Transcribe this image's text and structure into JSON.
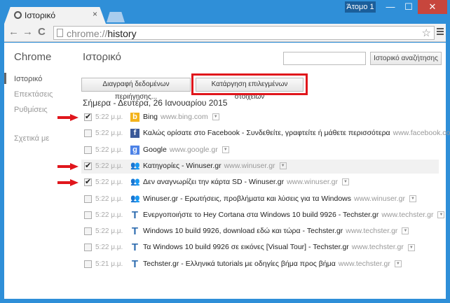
{
  "tab": {
    "title": "Ιστορικό",
    "close": "×"
  },
  "profile": "Άτομο 1",
  "window_buttons": {
    "minimize": "—",
    "maximize": "☐",
    "close": "✕"
  },
  "nav": {
    "back": "←",
    "forward": "→",
    "reload": "C"
  },
  "omnibox": {
    "scheme": "chrome://",
    "path": "history"
  },
  "sidebar": {
    "brand": "Chrome",
    "items": [
      "Ιστορικό",
      "Επεκτάσεις",
      "Ρυθμίσεις"
    ],
    "about": "Σχετικά με"
  },
  "main": {
    "title": "Ιστορικό",
    "search_placeholder": "",
    "search_button": "Ιστορικό αναζήτησης",
    "clear_button": "Διαγραφή δεδομένων περιήγησης...",
    "remove_button": "Κατάργηση επιλεγμένων στοιχείων",
    "date_heading": "Σήμερα - Δευτέρα, 26 Ιανουαρίου 2015"
  },
  "entries": [
    {
      "time": "5:22 μ.μ.",
      "title": "Bing",
      "domain": "www.bing.com",
      "checked": true,
      "icon": "bing-icon"
    },
    {
      "time": "5:22 μ.μ.",
      "title": "Καλώς ορίσατε στο Facebook - Συνδεθείτε, γραφτείτε ή μάθετε περισσότερα",
      "domain": "www.facebook.com",
      "checked": false,
      "icon": "facebook-icon"
    },
    {
      "time": "5:22 μ.μ.",
      "title": "Google",
      "domain": "www.google.gr",
      "checked": false,
      "icon": "google-icon"
    },
    {
      "time": "5:22 μ.μ.",
      "title": "Κατηγορίες - Winuser.gr",
      "domain": "www.winuser.gr",
      "checked": true,
      "icon": "winuser-icon"
    },
    {
      "time": "5:22 μ.μ.",
      "title": "Δεν αναγνωρίζει την κάρτα SD - Winuser.gr",
      "domain": "www.winuser.gr",
      "checked": true,
      "icon": "winuser-icon"
    },
    {
      "time": "5:22 μ.μ.",
      "title": "Winuser.gr - Ερωτήσεις, προβλήματα και λύσεις για τα Windows",
      "domain": "www.winuser.gr",
      "checked": false,
      "icon": "winuser-icon"
    },
    {
      "time": "5:22 μ.μ.",
      "title": "Ενεργοποιήστε το Hey Cortana στα Windows 10 build 9926 - Techster.gr",
      "domain": "www.techster.gr",
      "checked": false,
      "icon": "techster-icon"
    },
    {
      "time": "5:22 μ.μ.",
      "title": "Windows 10 build 9926, download εδώ και τώρα - Techster.gr",
      "domain": "www.techster.gr",
      "checked": false,
      "icon": "techster-icon"
    },
    {
      "time": "5:22 μ.μ.",
      "title": "Τα Windows 10 build 9926 σε εικόνες [Visual Tour] - Techster.gr",
      "domain": "www.techster.gr",
      "checked": false,
      "icon": "techster-icon"
    },
    {
      "time": "5:21 μ.μ.",
      "title": "Techster.gr - Ελληνικά tutorials με οδηγίες βήμα προς βήμα",
      "domain": "www.techster.gr",
      "checked": false,
      "icon": "techster-icon"
    }
  ],
  "colors": {
    "titlebar": "#2f8fd8",
    "highlight": "#e0161c",
    "arrow": "#e0161c"
  }
}
